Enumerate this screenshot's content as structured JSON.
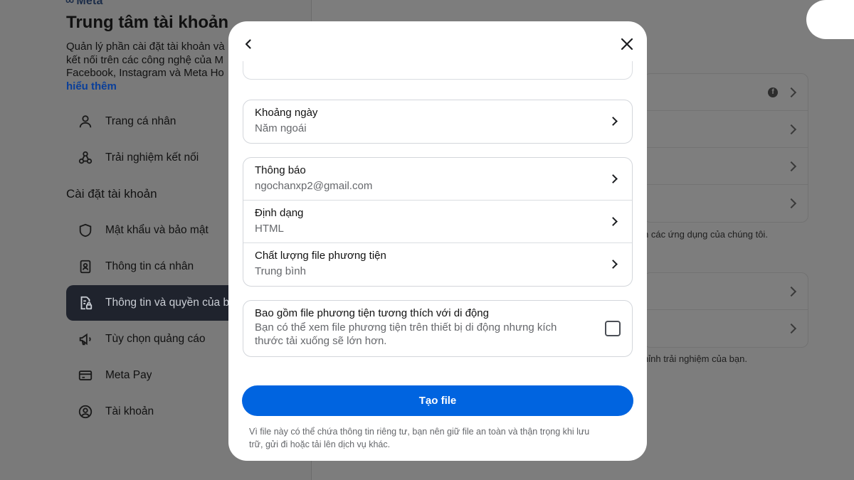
{
  "background": {
    "logo_text": "Meta",
    "title": "Trung tâm tài khoản",
    "description_lines": [
      "Quản lý phần cài đặt tài khoản và",
      "kết nối trên các công nghệ của M",
      "Facebook, Instagram và Meta Ho"
    ],
    "learn_more": "hiểu thêm",
    "nav_top": [
      {
        "label": "Trang cá nhân",
        "icon": "person-icon"
      },
      {
        "label": "Trải nghiệm kết nối",
        "icon": "connected-experiences-icon"
      }
    ],
    "section_label": "Cài đặt tài khoản",
    "nav_settings": [
      {
        "label": "Mật khẩu và bảo mật",
        "icon": "shield-icon"
      },
      {
        "label": "Thông tin cá nhân",
        "icon": "id-badge-icon"
      },
      {
        "label": "Thông tin và quyền của b",
        "icon": "document-lock-icon",
        "active": true
      },
      {
        "label": "Tùy chọn quảng cáo",
        "icon": "megaphone-icon"
      },
      {
        "label": "Meta Pay",
        "icon": "credit-card-icon"
      },
      {
        "label": "Tài khoản",
        "icon": "account-circle-icon"
      }
    ],
    "right_text_1": "n các ứng dụng của chúng tôi.",
    "right_text_2": "hỉnh trải nghiệm của bạn."
  },
  "modal": {
    "date_range": {
      "label": "Khoảng ngày",
      "value": "Năm ngoái"
    },
    "options": [
      {
        "label": "Thông báo",
        "value": "ngochanxp2@gmail.com"
      },
      {
        "label": "Định dạng",
        "value": "HTML"
      },
      {
        "label": "Chất lượng file phương tiện",
        "value": "Trung bình"
      }
    ],
    "mobile_media": {
      "label": "Bao gồm file phương tiện tương thích với di động",
      "description_lines": [
        "Bạn có thể xem file phương tiện trên thiết bị di động nhưng kích",
        "thước tải xuống sẽ lớn hơn."
      ],
      "checked": false
    },
    "create_button": "Tạo file",
    "footnote_lines": [
      "Vì file này có thể chứa thông tin riêng tư, bạn nên giữ file an toàn và thận trọng khi lưu",
      "trữ, gửi đi hoặc tải lên dịch vụ khác."
    ]
  },
  "colors": {
    "primary": "#0064e0",
    "overlay": "#787878",
    "active_nav": "#1f232d"
  }
}
